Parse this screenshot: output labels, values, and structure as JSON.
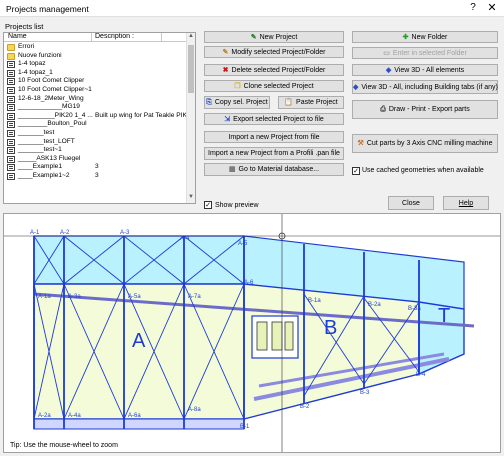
{
  "window": {
    "title": "Projects management",
    "help_glyph": "?",
    "close_glyph": "✕"
  },
  "projects_list_label": "Projects list",
  "list": {
    "columns": {
      "name": "Name",
      "description": "Description :"
    },
    "rows": [
      {
        "icon": "folder",
        "name": "Errori",
        "desc": ""
      },
      {
        "icon": "folder",
        "name": "Nuove funzioni",
        "desc": ""
      },
      {
        "icon": "file",
        "name": "1-4 topaz",
        "desc": ""
      },
      {
        "icon": "file",
        "name": "1-4 topaz_1",
        "desc": ""
      },
      {
        "icon": "file",
        "name": "10 Foot Comet Clipper",
        "desc": ""
      },
      {
        "icon": "file",
        "name": "10 Foot Comet Clipper~1",
        "desc": ""
      },
      {
        "icon": "file",
        "name": "12-6-18_2Meter_Wing",
        "desc": ""
      },
      {
        "icon": "file",
        "name": "____________MG19",
        "desc": ""
      },
      {
        "icon": "file",
        "name": "__________PIK20 1_4 ...",
        "desc": "Built up wing for Pat Teakle PIK20"
      },
      {
        "icon": "file",
        "name": "________Boulton_Poul",
        "desc": ""
      },
      {
        "icon": "file",
        "name": "_______test",
        "desc": ""
      },
      {
        "icon": "file",
        "name": "_______test_LOFT",
        "desc": ""
      },
      {
        "icon": "file",
        "name": "_______test~1",
        "desc": ""
      },
      {
        "icon": "file",
        "name": "_____ASK13 Fluegel",
        "desc": ""
      },
      {
        "icon": "file",
        "name": "____Example1",
        "desc": "3"
      },
      {
        "icon": "file",
        "name": "____Example1~2",
        "desc": "3"
      }
    ]
  },
  "buttons": {
    "new_project": "New Project",
    "modify_selected": "Modify selected Project/Folder",
    "delete_selected": "Delete selected Project/Folder",
    "clone_selected": "Clone selected Project",
    "copy_sel": "Copy sel. Project",
    "paste": "Paste Project",
    "export_file": "Export selected Project to file",
    "import_file": "Import a new Project from file",
    "import_profili": "Import a new Project from a Profili .pan file",
    "material_db": "Go to Material database...",
    "new_folder": "New Folder",
    "enter_folder": "Enter in selected Folder",
    "view3d_all": "View 3D - All elements",
    "view3d_building": "View 3D - All, including Building tabs (if any)",
    "draw_print": "Draw - Print - Export parts",
    "cnc": "Cut parts by 3 Axis CNC milling machine",
    "close": "Close",
    "help": "Help"
  },
  "checkboxes": {
    "use_cached": {
      "label": "Use cached geometries when available",
      "checked": true
    },
    "show_preview": {
      "label": "Show preview",
      "checked": true
    }
  },
  "preview": {
    "tip": "Tip: Use the mouse-wheel to zoom",
    "big_labels": {
      "A": "A",
      "B": "B",
      "T": "T"
    },
    "top_labels": [
      "A-1",
      "A-2",
      "A-3",
      "A-4",
      "A-5",
      "A-6"
    ],
    "a_mid_labels": [
      "A-1a",
      "A-3a",
      "A-5a",
      "A-7a"
    ],
    "a_low_labels": [
      "A-2a",
      "A-4a",
      "A-6a",
      "A-8a"
    ],
    "b_labels": [
      "B-1a",
      "B-2a",
      "B-3a",
      "B-1",
      "B-2",
      "B-3",
      "B-4"
    ]
  },
  "colors": {
    "accent_blue": "#1d3bd6",
    "sky_fill": "#b9f1ff",
    "rib_fill": "#f4fbd8",
    "spar": "#6c6cc8"
  }
}
